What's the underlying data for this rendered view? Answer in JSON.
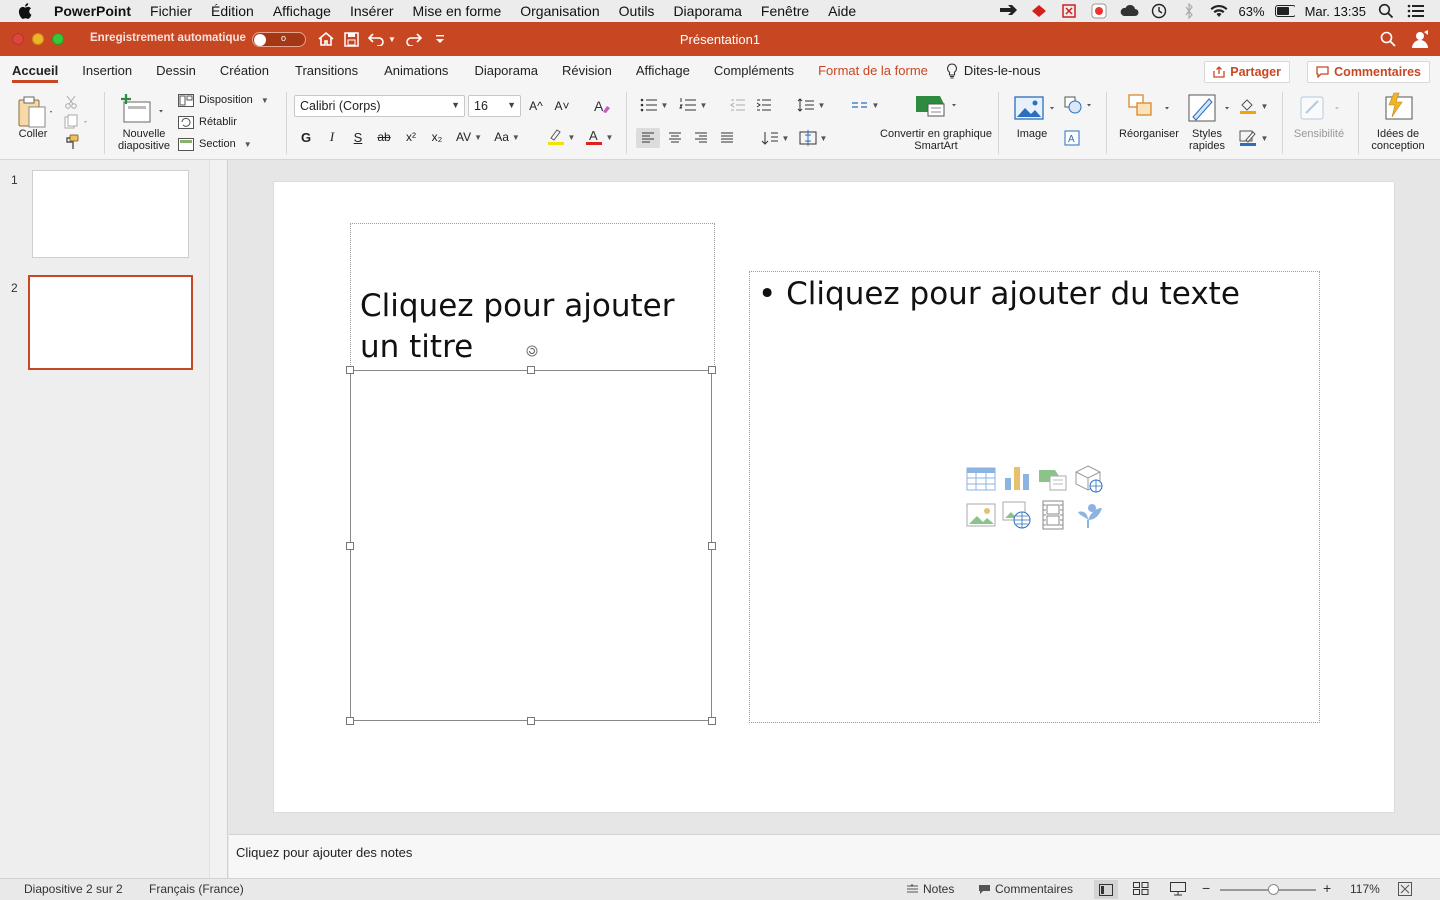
{
  "menubar": {
    "app_name": "PowerPoint",
    "items": [
      "Fichier",
      "Édition",
      "Affichage",
      "Insérer",
      "Mise en forme",
      "Organisation",
      "Outils",
      "Diaporama",
      "Fenêtre",
      "Aide"
    ],
    "battery": "63%",
    "clock": "Mar. 13:35"
  },
  "titlebar": {
    "autosave_label": "Enregistrement automatique",
    "autosave_state": "o",
    "document_title": "Présentation1"
  },
  "tabs": {
    "items": [
      "Accueil",
      "Insertion",
      "Dessin",
      "Création",
      "Transitions",
      "Animations",
      "Diaporama",
      "Révision",
      "Affichage",
      "Compléments"
    ],
    "contextual": "Format de la forme",
    "tell_me": "Dites-le-nous",
    "share": "Partager",
    "comments": "Commentaires"
  },
  "ribbon": {
    "paste": "Coller",
    "new_slide": "Nouvelle diapositive",
    "layout": "Disposition",
    "reset": "Rétablir",
    "section": "Section",
    "font_name": "Calibri (Corps)",
    "font_size": "16",
    "bold": "G",
    "italic": "I",
    "underline": "S",
    "strikethrough": "ab",
    "superscript": "x²",
    "subscript": "x₂",
    "char_spacing": "AV",
    "change_case": "Aa",
    "grow_font": "A^",
    "shrink_font": "A˅",
    "font_color_letter": "A",
    "convert_smartart": "Convertir en graphique SmartArt",
    "image": "Image",
    "arrange": "Réorganiser",
    "quick_styles": "Styles rapides",
    "sensitivity": "Sensibilité",
    "design_ideas": "Idées de conception",
    "colors": {
      "accent": "#c74723",
      "highlight": "#f2e300",
      "font_color": "#e0201c"
    }
  },
  "thumbnails": {
    "items": [
      {
        "number": "1"
      },
      {
        "number": "2"
      }
    ]
  },
  "slide": {
    "title_placeholder": "Cliquez pour ajouter un titre",
    "content_placeholder": "• Cliquez pour ajouter du texte"
  },
  "notes": {
    "placeholder": "Cliquez pour ajouter des notes"
  },
  "statusbar": {
    "slide_info": "Diapositive 2 sur 2",
    "language": "Français (France)",
    "notes": "Notes",
    "comments": "Commentaires",
    "zoom": "117%",
    "zoom_level": 0.55
  }
}
